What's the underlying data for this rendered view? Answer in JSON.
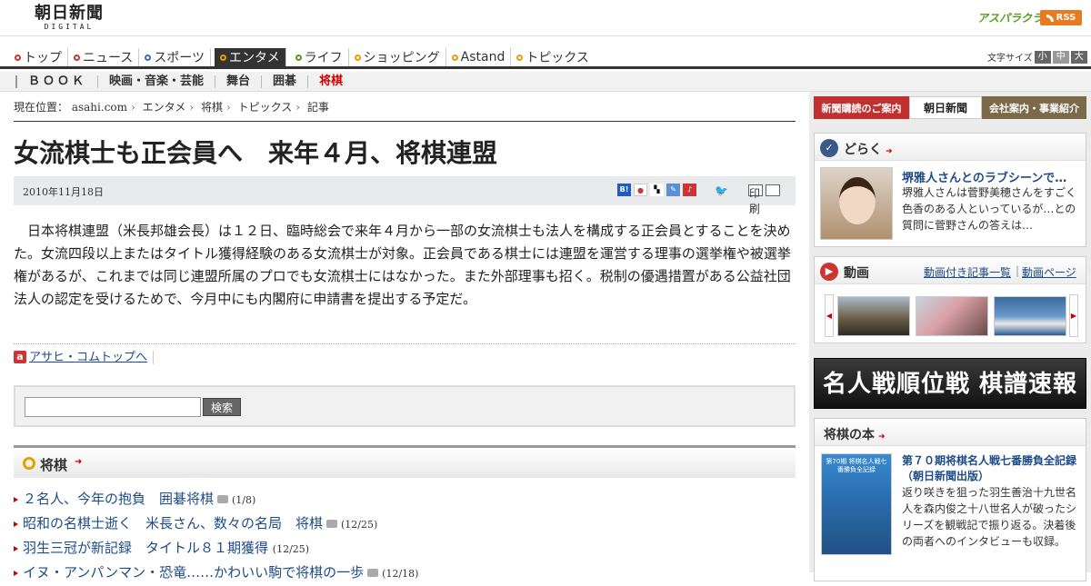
{
  "header": {
    "logo_main": "朝日新聞",
    "logo_sub": "DIGITAL",
    "asupara": "アスパラクラブ",
    "rss": "RSS"
  },
  "nav": {
    "items": [
      {
        "label": "トップ",
        "dot": "#c33"
      },
      {
        "label": "ニュース",
        "dot": "#c33"
      },
      {
        "label": "スポーツ",
        "dot": "#3a6fb0"
      },
      {
        "label": "エンタメ",
        "dot": "#e3a000"
      },
      {
        "label": "ライフ",
        "dot": "#5a9a1a"
      },
      {
        "label": "ショッピング",
        "dot": "#e3a000"
      },
      {
        "label": "Astand",
        "dot": "#e3a000"
      },
      {
        "label": "トピックス",
        "dot": "#e3a000"
      }
    ],
    "selected": "エンタメ",
    "font_size_label": "文字サイズ",
    "font_sizes": [
      "小",
      "中",
      "大"
    ]
  },
  "subnav": {
    "items": [
      "ＢＯＯＫ",
      "映画・音楽・芸能",
      "舞台",
      "囲碁",
      "将棋"
    ],
    "selected": "将棋"
  },
  "breadcrumb": {
    "label": "現在位置：",
    "items": [
      "asahi.com",
      "エンタメ",
      "将棋",
      "トピックス",
      "記事"
    ]
  },
  "article": {
    "title": "女流棋士も正会員へ　来年４月、将棋連盟",
    "date": "2010年11月18日",
    "print_label": "印刷",
    "body": "日本将棋連盟（米長邦雄会長）は１２日、臨時総会で来年４月から一部の女流棋士も法人を構成する正会員とすることを決めた。女流四段以上またはタイトル獲得経験のある女流棋士が対象。正会員である棋士には連盟を運営する理事の選挙権や被選挙権があるが、これまでは同じ連盟所属のプロでも女流棋士にはなかった。また外部理事も招く。税制の優遇措置がある公益社団法人の認定を受けるためで、今月中にも内閣府に申請書を提出する予定だ。"
  },
  "links": {
    "top_link": "アサヒ・コムトップへ"
  },
  "search": {
    "value": "",
    "button": "検索"
  },
  "shogi": {
    "heading": "将棋",
    "topics": [
      {
        "title": "２名人、今年の抱負　囲碁将棋",
        "photo": true,
        "date": "(1/8)"
      },
      {
        "title": "昭和の名棋士逝く　米長さん、数々の名局　将棋",
        "photo": true,
        "date": "(12/25)"
      },
      {
        "title": "羽生三冠が新記録　タイトル８１期獲得",
        "photo": false,
        "date": "(12/25)"
      },
      {
        "title": "イヌ・アンパンマン・恐竜……かわいい駒で将棋の一歩",
        "photo": true,
        "date": "(12/18)"
      }
    ]
  },
  "sidebar": {
    "ads": [
      "新聞購読のご案内",
      "朝日新聞",
      "会社案内・事業紹介"
    ],
    "doraku": {
      "heading": "どらく",
      "headline": "堺雅人さんとのラブシーンで…",
      "text": "堺雅人さんは菅野美穂さんをすごく色香のある人といっているが…との質問に菅野さんの答えは…"
    },
    "video": {
      "heading": "動画",
      "link1": "動画付き記事一覧",
      "sep": "|",
      "link2": "動画ページ"
    },
    "meijin_banner": "名人戦順位戦 棋譜速報",
    "book": {
      "heading": "将棋の本",
      "cover_text": "第70期 将棋名人戦七番勝負全記録",
      "title": "第７０期将棋名人戦七番勝負全記録（朝日新聞出版）",
      "text": "返り咲きを狙った羽生善治十九世名人を森内俊之十八世名人が破ったシリーズを観戦記で振り返る。決着後の両者へのインタビューも収録。"
    }
  }
}
